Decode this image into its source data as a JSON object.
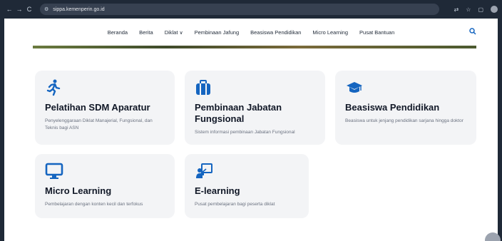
{
  "browser": {
    "url": "sippa.kemenperin.go.id",
    "back_icon": "←",
    "forward_icon": "→",
    "reload_icon": "C",
    "right_icons": [
      "translate-icon",
      "star-icon",
      "extensions-icon",
      "avatar-icon"
    ]
  },
  "nav": {
    "items": [
      {
        "label": "Beranda"
      },
      {
        "label": "Berita"
      },
      {
        "label": "Diklat"
      },
      {
        "label": "Pembinaan Jafung"
      },
      {
        "label": "Beasiswa Pendidikan"
      },
      {
        "label": "Micro Learning"
      },
      {
        "label": "Pusat Bantuan"
      }
    ]
  },
  "cards": [
    {
      "title": "Pelatihan SDM Aparatur",
      "desc": "Penyelenggaraan Diklat Manajerial, Fungsional, dan Teknis bagi ASN",
      "icon": "running-person-icon"
    },
    {
      "title": "Pembinaan Jabatan Fungsional",
      "desc": "Sistem informasi pembinaan Jabatan Fungsional",
      "icon": "briefcase-icon"
    },
    {
      "title": "Beasiswa Pendidikan",
      "desc": "Beasiswa untuk jenjang pendidikan sarjana hingga doktor",
      "icon": "graduation-cap-icon"
    },
    {
      "title": "Micro Learning",
      "desc": "Pembelajaran dengan konten kecil dan terfokus",
      "icon": "monitor-icon"
    },
    {
      "title": "E-learning",
      "desc": "Pusat pembelajaran bagi peserta diklat",
      "icon": "teacher-board-icon"
    }
  ],
  "colors": {
    "accent": "#1565c0",
    "card_bg": "#f3f4f6",
    "chrome": "#1f2937"
  }
}
